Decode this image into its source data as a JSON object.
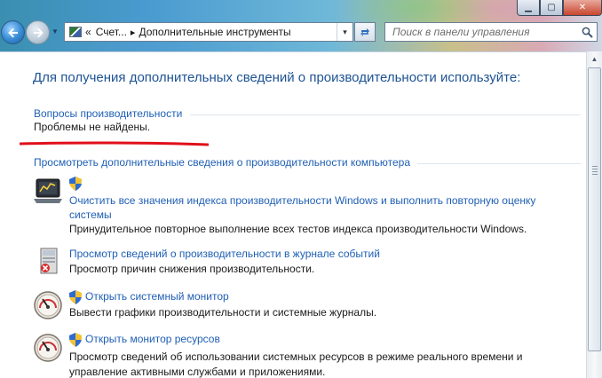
{
  "window": {
    "controls": {
      "minimize": "▁",
      "maximize": "▢",
      "close": "✕"
    }
  },
  "nav": {
    "back_icon": "back-arrow-icon",
    "forward_icon": "forward-arrow-icon"
  },
  "address": {
    "overflow": "«",
    "crumb_1": "Счет...",
    "separator": "▸",
    "crumb_2": "Дополнительные инструменты",
    "dropdown_icon": "▾"
  },
  "search": {
    "placeholder": "Поиск в панели управления"
  },
  "main": {
    "title": "Для получения дополнительных сведений о производительности используйте:",
    "section_1": {
      "link": "Вопросы производительности",
      "status": "Проблемы не найдены."
    },
    "section_2": {
      "link": "Просмотреть дополнительные сведения о производительности компьютера"
    },
    "tasks": [
      {
        "link_line_1": "Очистить все значения индекса производительности Windows и выполнить повторную оценку",
        "link_line_2": "системы",
        "description": "Принудительное повторное выполнение всех тестов индекса производительности Windows."
      },
      {
        "link_line_1": "Просмотр сведений о производительности в журнале событий",
        "description": "Просмотр причин снижения производительности."
      },
      {
        "link_line_1": "Открыть системный монитор",
        "description": "Вывести графики производительности и системные журналы."
      },
      {
        "link_line_1": "Открыть монитор ресурсов",
        "description_line_1": "Просмотр сведений об использовании системных ресурсов в режиме реального времени и",
        "description_line_2": "управление активными службами и приложениями."
      }
    ]
  },
  "colors": {
    "link": "#1f5fb4",
    "title": "#1e5394",
    "highlight_underline": "#e0101b"
  }
}
